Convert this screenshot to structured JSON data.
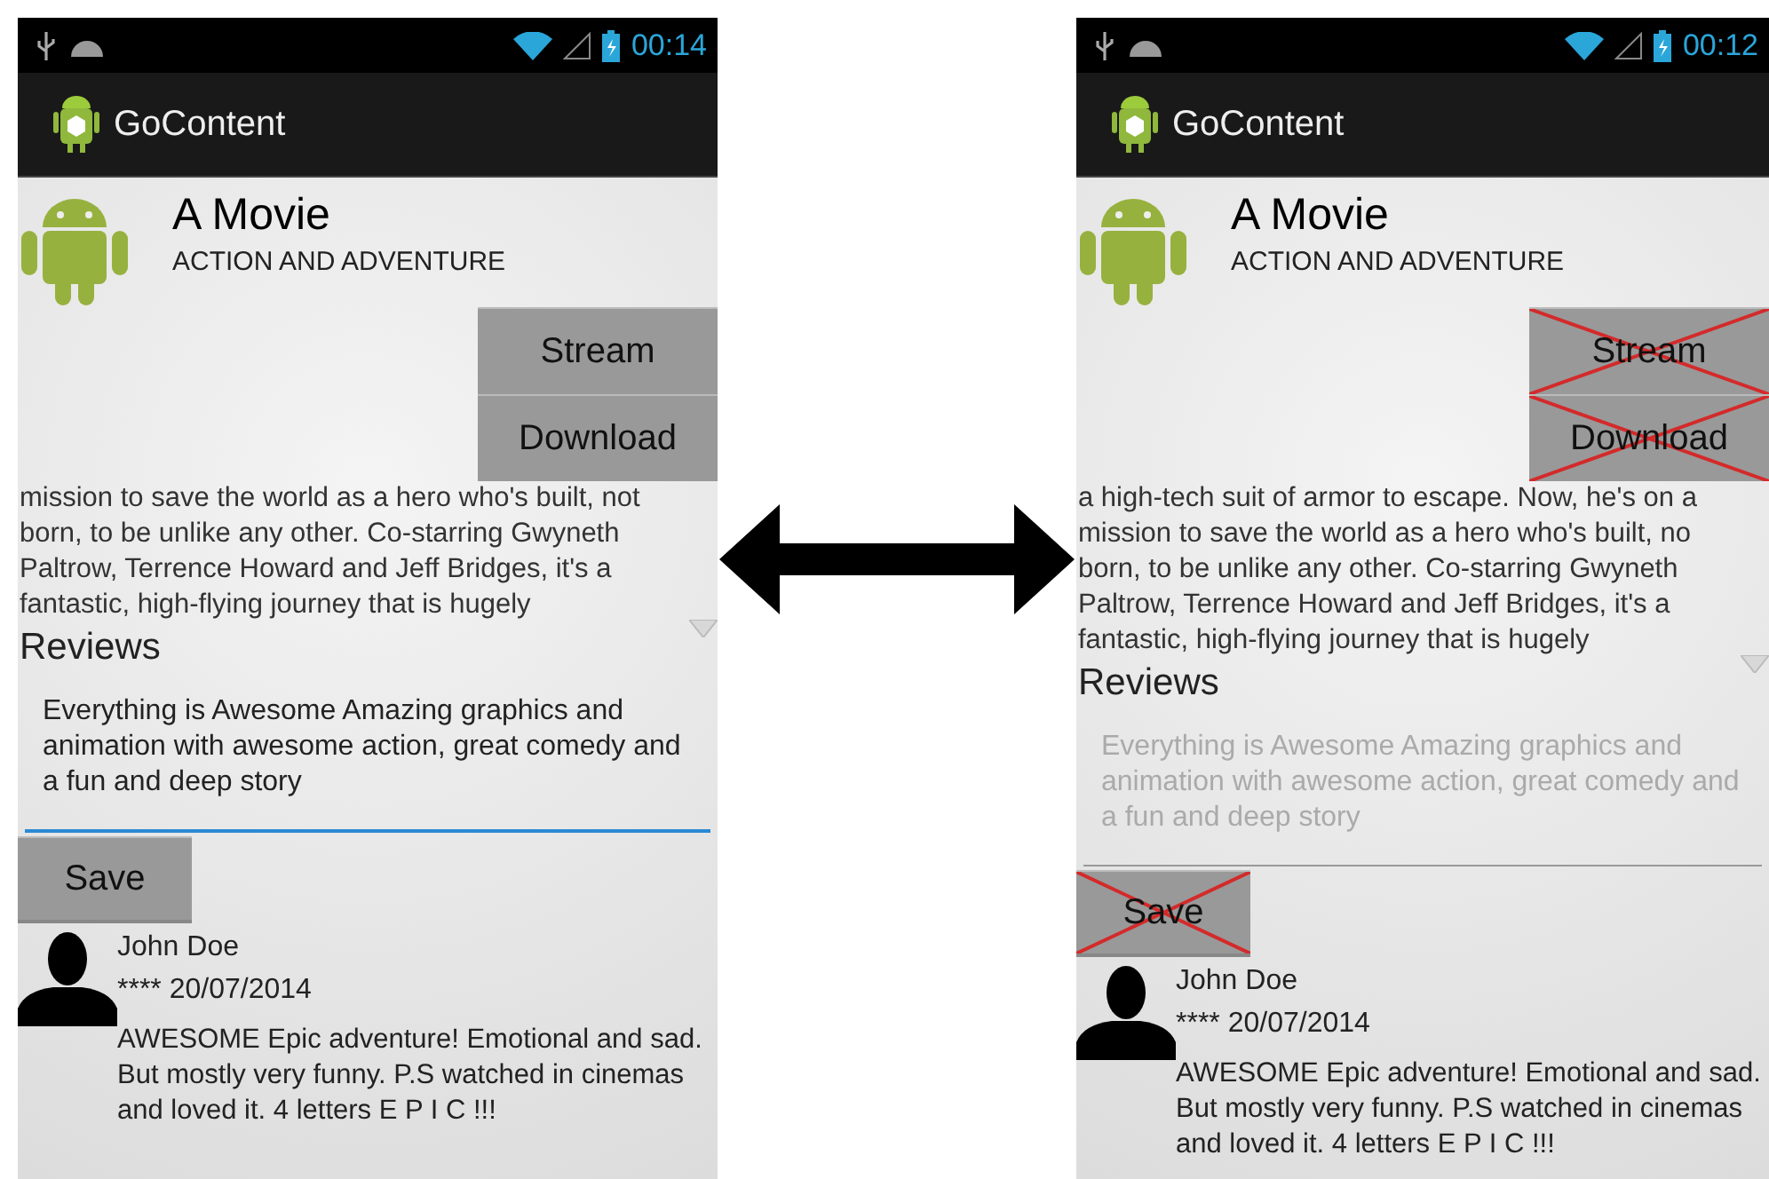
{
  "screens": [
    {
      "status_time": "00:14",
      "app_title": "GoContent",
      "movie_title": "A Movie",
      "genre": "ACTION AND ADVENTURE",
      "buttons": [
        {
          "label": "Stream",
          "crossed_out": false
        },
        {
          "label": "Download",
          "crossed_out": false
        }
      ],
      "description_lines": [
        "mission to save the world as a hero who's built, not",
        "born, to be unlike any other. Co-starring Gwyneth",
        "Paltrow, Terrence Howard and Jeff Bridges, it's a",
        "fantastic, high-flying journey that is hugely"
      ],
      "reviews_heading": "Reviews",
      "review_field": {
        "value": "Everything is Awesome Amazing graphics and animation with awesome action, great comedy and a fun and deep story",
        "focused": true,
        "disabled": false
      },
      "save_button": {
        "label": "Save",
        "crossed_out": false
      },
      "reviews": [
        {
          "name": "John Doe",
          "rating_date": "**** 20/07/2014",
          "text": "AWESOME Epic adventure! Emotional and sad. But mostly very funny. P.S watched in cinemas and loved it. 4 letters E P I C !!!"
        }
      ]
    },
    {
      "status_time": "00:12",
      "app_title": "GoContent",
      "movie_title": "A Movie",
      "genre": "ACTION AND ADVENTURE",
      "buttons": [
        {
          "label": "Stream",
          "crossed_out": true
        },
        {
          "label": "Download",
          "crossed_out": true
        }
      ],
      "description_lines": [
        "a high-tech suit of armor to escape. Now, he's on a",
        "mission to save the world as a hero who's built, no",
        "born, to be unlike any other. Co-starring Gwyneth",
        "Paltrow, Terrence Howard and Jeff Bridges, it's a",
        "fantastic, high-flying journey that is hugely"
      ],
      "reviews_heading": "Reviews",
      "review_field": {
        "value": "Everything is Awesome Amazing graphics and animation with awesome action, great comedy and a fun and deep story",
        "focused": false,
        "disabled": true
      },
      "save_button": {
        "label": "Save",
        "crossed_out": true
      },
      "reviews": [
        {
          "name": "John Doe",
          "rating_date": "**** 20/07/2014",
          "text": "AWESOME Epic adventure! Emotional and sad. But mostly very funny. P.S watched in cinemas and loved it. 4 letters E P I C !!!"
        }
      ]
    }
  ]
}
